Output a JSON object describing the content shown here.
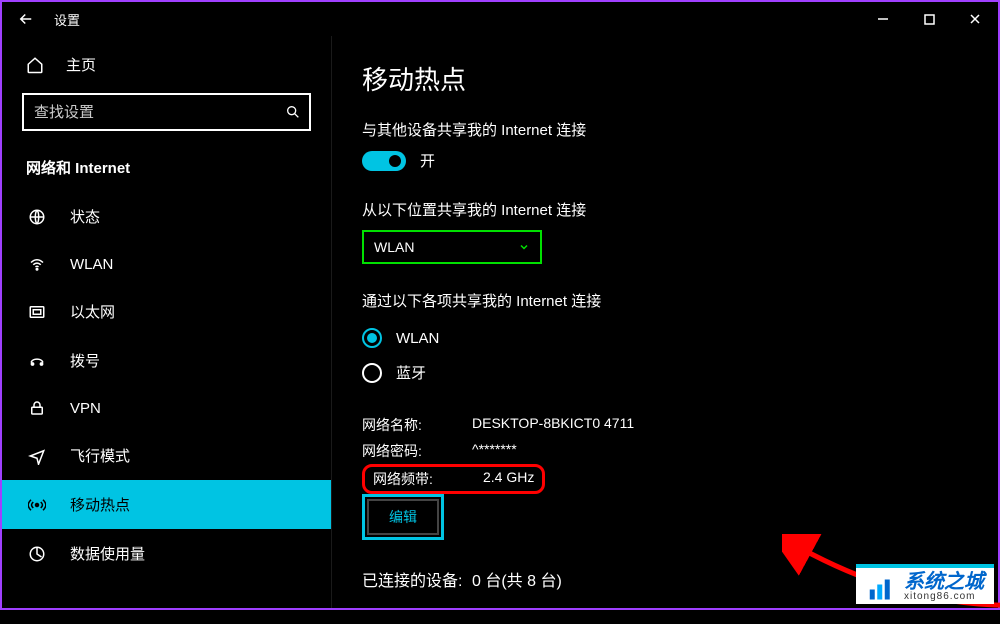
{
  "window": {
    "title": "设置"
  },
  "sidebar": {
    "home": "主页",
    "search_placeholder": "查找设置",
    "category": "网络和 Internet",
    "items": [
      {
        "label": "状态"
      },
      {
        "label": "WLAN"
      },
      {
        "label": "以太网"
      },
      {
        "label": "拨号"
      },
      {
        "label": "VPN"
      },
      {
        "label": "飞行模式"
      },
      {
        "label": "移动热点"
      },
      {
        "label": "数据使用量"
      }
    ]
  },
  "content": {
    "title": "移动热点",
    "share_label": "与其他设备共享我的 Internet 连接",
    "toggle_state": "开",
    "share_from_label": "从以下位置共享我的 Internet 连接",
    "share_from_value": "WLAN",
    "share_via_label": "通过以下各项共享我的 Internet 连接",
    "radios": [
      {
        "label": "WLAN",
        "selected": true
      },
      {
        "label": "蓝牙",
        "selected": false
      }
    ],
    "info": {
      "name_label": "网络名称:",
      "name_value": "DESKTOP-8BKICT0 4711",
      "pwd_label": "网络密码:",
      "pwd_value": "^*******",
      "band_label": "网络频带:",
      "band_value": "2.4 GHz"
    },
    "edit_btn": "编辑",
    "connected_label": "已连接的设备:",
    "connected_value": "0 台(共 8 台)"
  },
  "watermark": {
    "big": "系统之城",
    "small": "xitong86.com"
  }
}
